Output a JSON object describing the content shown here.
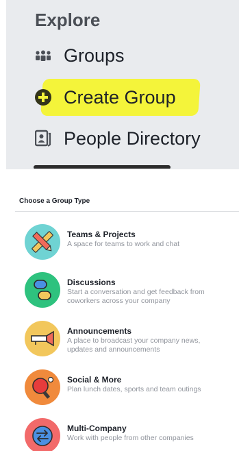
{
  "explore": {
    "title": "Explore",
    "items": [
      {
        "label": "Groups",
        "icon": "groups-icon"
      },
      {
        "label": "Create Group",
        "icon": "plus-circle-icon"
      },
      {
        "label": "People Directory",
        "icon": "directory-icon"
      }
    ],
    "highlight_color": "#f4f43a"
  },
  "panel": {
    "header": "Choose a Group Type",
    "types": [
      {
        "title": "Teams & Projects",
        "description": "A space for teams to work and chat",
        "icon": "pencil-ruler-icon",
        "color": "#6fd3d3"
      },
      {
        "title": "Discussions",
        "description": "Start a conversation and get feedback from coworkers across your company",
        "icon": "speech-bubbles-icon",
        "color": "#2ec27e"
      },
      {
        "title": "Announcements",
        "description": "A place to broadcast your company news, updates and announcements",
        "icon": "megaphone-icon",
        "color": "#f2c75c"
      },
      {
        "title": "Social & More",
        "description": "Plan lunch dates, sports and team outings",
        "icon": "ping-pong-icon",
        "color": "#f08a3c"
      },
      {
        "title": "Multi-Company",
        "description": "Work with people from other companies",
        "icon": "exchange-arrows-icon",
        "color": "#f26a6a"
      }
    ]
  }
}
